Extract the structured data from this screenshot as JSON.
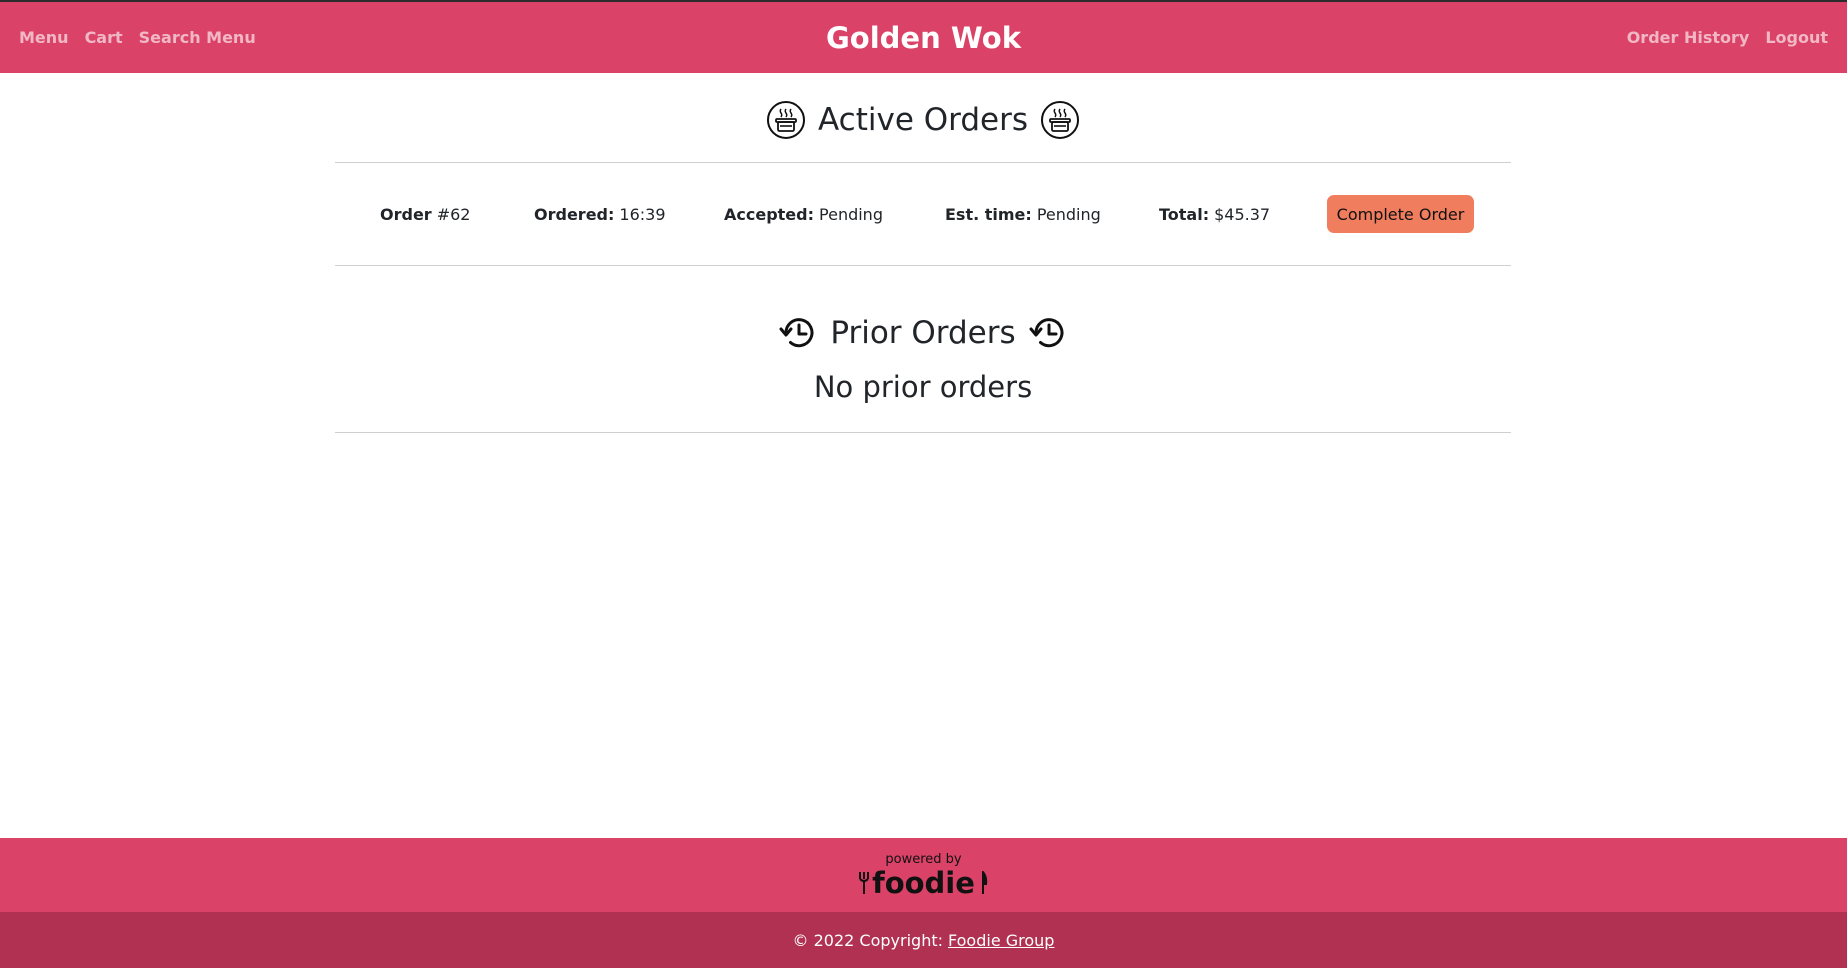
{
  "navbar": {
    "left_links": [
      "Menu",
      "Cart",
      "Search Menu"
    ],
    "brand": "Golden Wok",
    "right_links": [
      "Order History",
      "Logout"
    ],
    "color": "#da4268"
  },
  "active_orders": {
    "title": "Active Orders",
    "icon": "cooking-pot-icon",
    "orders": [
      {
        "order_label": "Order",
        "order_number": "#62",
        "ordered_label": "Ordered:",
        "ordered_value": "16:39",
        "accepted_label": "Accepted:",
        "accepted_value": "Pending",
        "est_label": "Est. time:",
        "est_value": "Pending",
        "total_label": "Total:",
        "total_value": "$45.37",
        "action_label": "Complete Order"
      }
    ]
  },
  "prior_orders": {
    "title": "Prior Orders",
    "icon": "history-icon",
    "empty_message": "No prior orders"
  },
  "footer": {
    "powered_by": "powered by",
    "logo_text": "foodie",
    "copyright": "© 2022 Copyright:",
    "copyright_link": "Foodie Group",
    "color_top": "#da4268",
    "color_bottom": "#b03151"
  },
  "button_color": "#f07d5e"
}
